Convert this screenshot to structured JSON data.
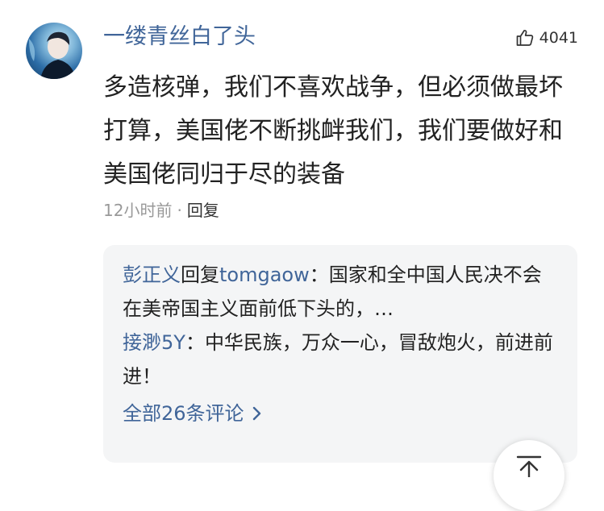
{
  "comment": {
    "username": "一缕青丝白了头",
    "like_count": "4041",
    "text": "多造核弹，我们不喜欢战争，但必须做最坏打算，美国佬不断挑衅我们，我们要做好和美国佬同归于尽的装备",
    "time": "12小时前",
    "dot": "·",
    "reply_label": "回复"
  },
  "replies": {
    "items": [
      {
        "author": "彭正义",
        "reply_word": "回复",
        "target": "tomgaow",
        "separator": "：",
        "text": "国家和全中国人民决不会在美帝国主义面前低下头的，…"
      },
      {
        "author": "接渺5Y",
        "separator": "：",
        "text": "中华民族，万众一心，冒敌炮火，前进前进！"
      }
    ],
    "all_label": "全部26条评论"
  },
  "colors": {
    "link": "#406599",
    "text": "#222222",
    "muted": "#999999",
    "reply_bg": "#f4f5f6"
  },
  "icons": {
    "like": "thumbs-up-icon",
    "more": "chevron-right-icon",
    "top": "back-to-top-icon"
  }
}
